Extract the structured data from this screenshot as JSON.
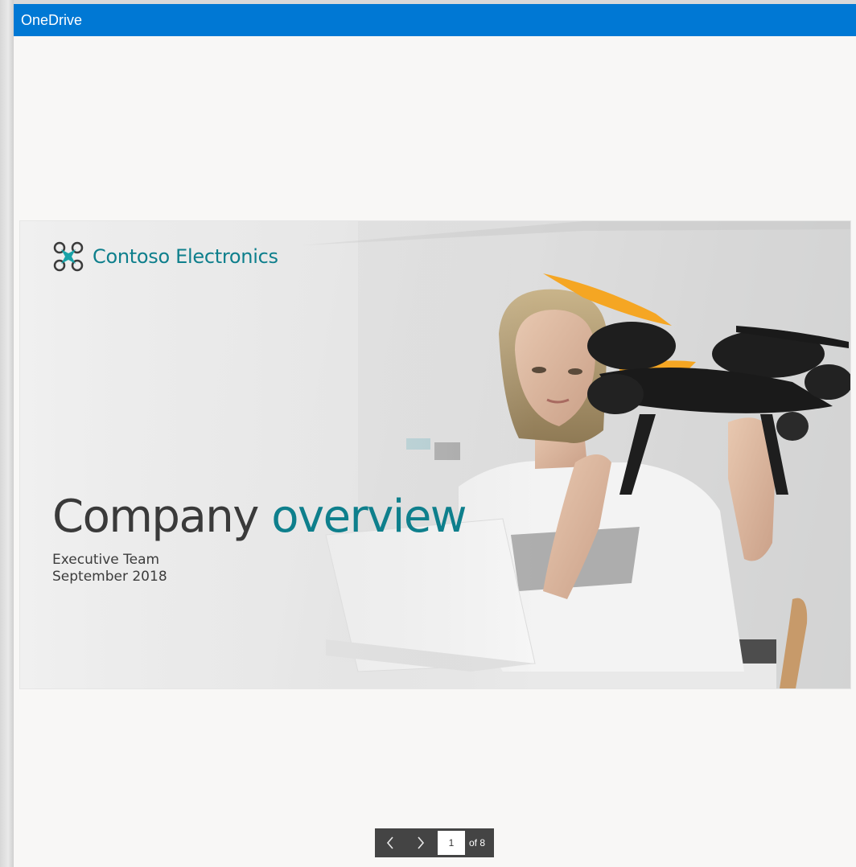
{
  "window": {
    "title": "OneDrive"
  },
  "slide": {
    "brand": "Contoso Electronics",
    "headline_part1": "Company",
    "headline_part2": "overview",
    "subtitle_line1": "Executive Team",
    "subtitle_line2": "September 2018"
  },
  "pager": {
    "prev_icon": "chevron-left-icon",
    "next_icon": "chevron-right-icon",
    "current_page": "1",
    "total_label": "of 8"
  },
  "colors": {
    "titlebar": "#0078d4",
    "brand_teal": "#0e7f8c",
    "pager_bg": "#444444",
    "drone_propeller": "#f5a623"
  }
}
